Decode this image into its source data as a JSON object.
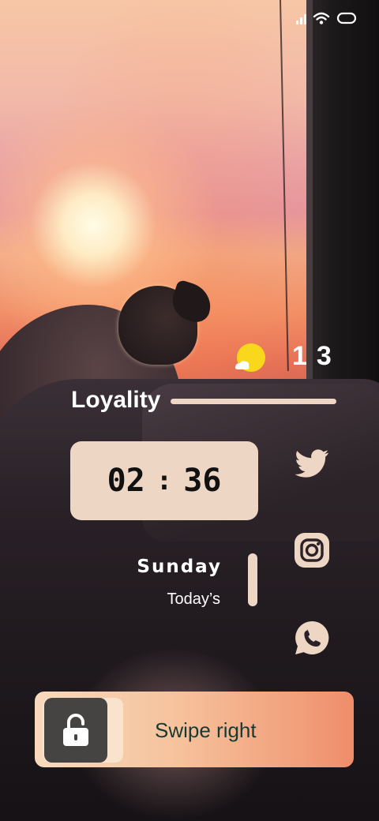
{
  "status_bar": {
    "signal_icon": "signal-bars-icon",
    "wifi_icon": "wifi-icon",
    "battery_icon": "battery-icon"
  },
  "weather": {
    "icon": "sun-behind-cloud-icon",
    "date_number": "13"
  },
  "widget": {
    "title": "Loyality",
    "time": {
      "hours": "02",
      "separator": ":",
      "minutes": "36"
    },
    "day": "Sunday",
    "subtitle": "Today’s"
  },
  "social": [
    {
      "icon": "twitter-icon"
    },
    {
      "icon": "instagram-icon"
    },
    {
      "icon": "whatsapp-icon"
    }
  ],
  "unlock": {
    "label": "Swipe right",
    "icon": "unlocked-padlock-icon"
  },
  "colors": {
    "accent": "#eed6c4",
    "swipe_text": "#173a33",
    "handle": "#464443"
  }
}
